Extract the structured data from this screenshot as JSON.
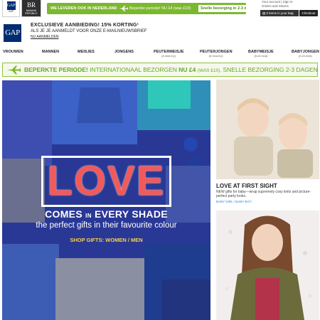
{
  "top_bar": {
    "gap_tab_logo": "GAP",
    "gap_tab_caption": "GAP",
    "br_tab_logo": "BR",
    "br_tab_caption": "BANANA REPUBLIC",
    "shipping_nl": "WE LEVEREN OOK IN NEDERLAND",
    "shipping_offer": "Beperkte periode! NU £4 (was £10)",
    "shipping_fast": "Snelle bezorging in 2-3 dagen",
    "account_line": "Your account | Sign in",
    "orders_line": "Orders and returns",
    "cart_label": "0 items in your bag",
    "checkout_label": "Checkout"
  },
  "header": {
    "logo": "GAP",
    "offer_title": "EXCLUSIEVE AANBIEDING! 15% KORTING¹",
    "offer_sub": "ALS JE JE AANMELDT VOOR ONZE E-MAILNIEUWSBRIEF",
    "offer_link": "NU AANMELDEN"
  },
  "nav": [
    {
      "label": "VROUWEN",
      "sub": ""
    },
    {
      "label": "MANNEN",
      "sub": ""
    },
    {
      "label": "MEISJES",
      "sub": ""
    },
    {
      "label": "JONGENS",
      "sub": ""
    },
    {
      "label": "PEUTERMEISJE",
      "sub": "(6 mnd-5 jr)"
    },
    {
      "label": "PEUTERJONGEN",
      "sub": "(6 mnd-5 jr)"
    },
    {
      "label": "BABYMEISJE",
      "sub": "(0-24 mnd)"
    },
    {
      "label": "BABYJONGEN",
      "sub": "(0-24 mnd)"
    }
  ],
  "banner": {
    "lead": "BEPERKTE PERIODE!",
    "mid": "INTERNATIONAAL BEZORGEN",
    "price": "NU £4",
    "was": "(WAS £10).",
    "tail": "SNELLE BEZORGING 2-3 DAGEN"
  },
  "hero": {
    "headline": "LOVE",
    "line1_a": "COMES",
    "line1_in": "IN",
    "line1_b": "EVERY SHADE",
    "subline": "the perfect gifts in their favourite colour",
    "shop_line": "SHOP GIFTS: WOMEN / MEN"
  },
  "promos": [
    {
      "title": "LOVE AT FIRST SIGHT",
      "desc": "NEW gifts for baby—wrap supremely cosy knits and picture-perfect party looks.",
      "link": "BABY GIRL / BABY BOY"
    }
  ],
  "colors": {
    "gap_navy": "#002d72",
    "promo_green": "#7cb82f",
    "banner_green": "#6aa52a",
    "love_red": "#f25a5a",
    "hero_blue": "#2c3a9a",
    "shop_yellow": "#f7d14a",
    "link_blue": "#3a7bd5"
  },
  "icons": [
    "plane-icon",
    "cart-icon"
  ]
}
